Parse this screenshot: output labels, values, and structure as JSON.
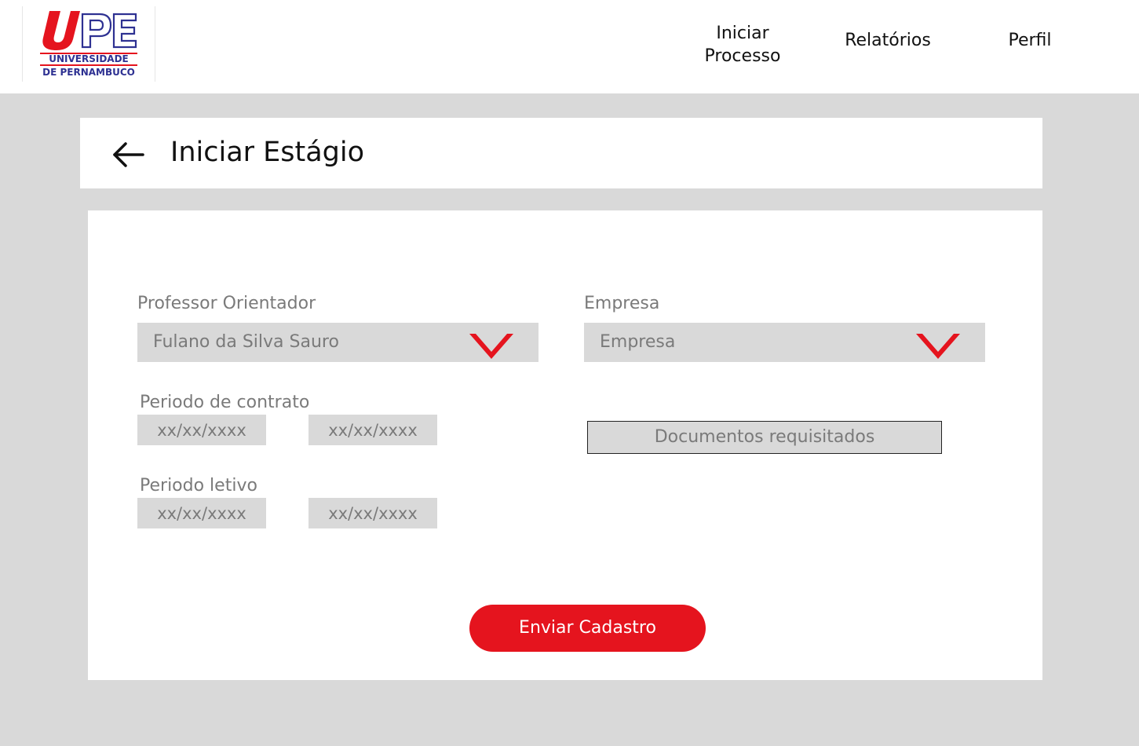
{
  "colors": {
    "accent_red": "#e5141e",
    "logo_blue": "#2e3192",
    "field_gray": "#d9d9d9",
    "muted_text": "#7a7a7a"
  },
  "brand": {
    "logo_line1": "UNIVERSIDADE",
    "logo_line2": "DE PERNAMBUCO"
  },
  "nav": {
    "iniciar_processo_line1": "Iniciar",
    "iniciar_processo_line2": "Processo",
    "relatorios": "Relatórios",
    "perfil": "Perfil"
  },
  "header": {
    "back_icon": "arrow-left-icon",
    "title": "Iniciar Estágio"
  },
  "form": {
    "professor": {
      "label": "Professor Orientador",
      "value": "Fulano da Silva Sauro",
      "icon": "chevron-down-icon"
    },
    "empresa": {
      "label": "Empresa",
      "value": "Empresa",
      "icon": "chevron-down-icon"
    },
    "periodo_contrato": {
      "label": "Periodo de contrato",
      "start_placeholder": "xx/xx/xxxx",
      "end_placeholder": "xx/xx/xxxx"
    },
    "periodo_letivo": {
      "label": "Periodo letivo",
      "start_placeholder": "xx/xx/xxxx",
      "end_placeholder": "xx/xx/xxxx"
    },
    "documentos_button": "Documentos requisitados",
    "submit_button": "Enviar Cadastro"
  }
}
